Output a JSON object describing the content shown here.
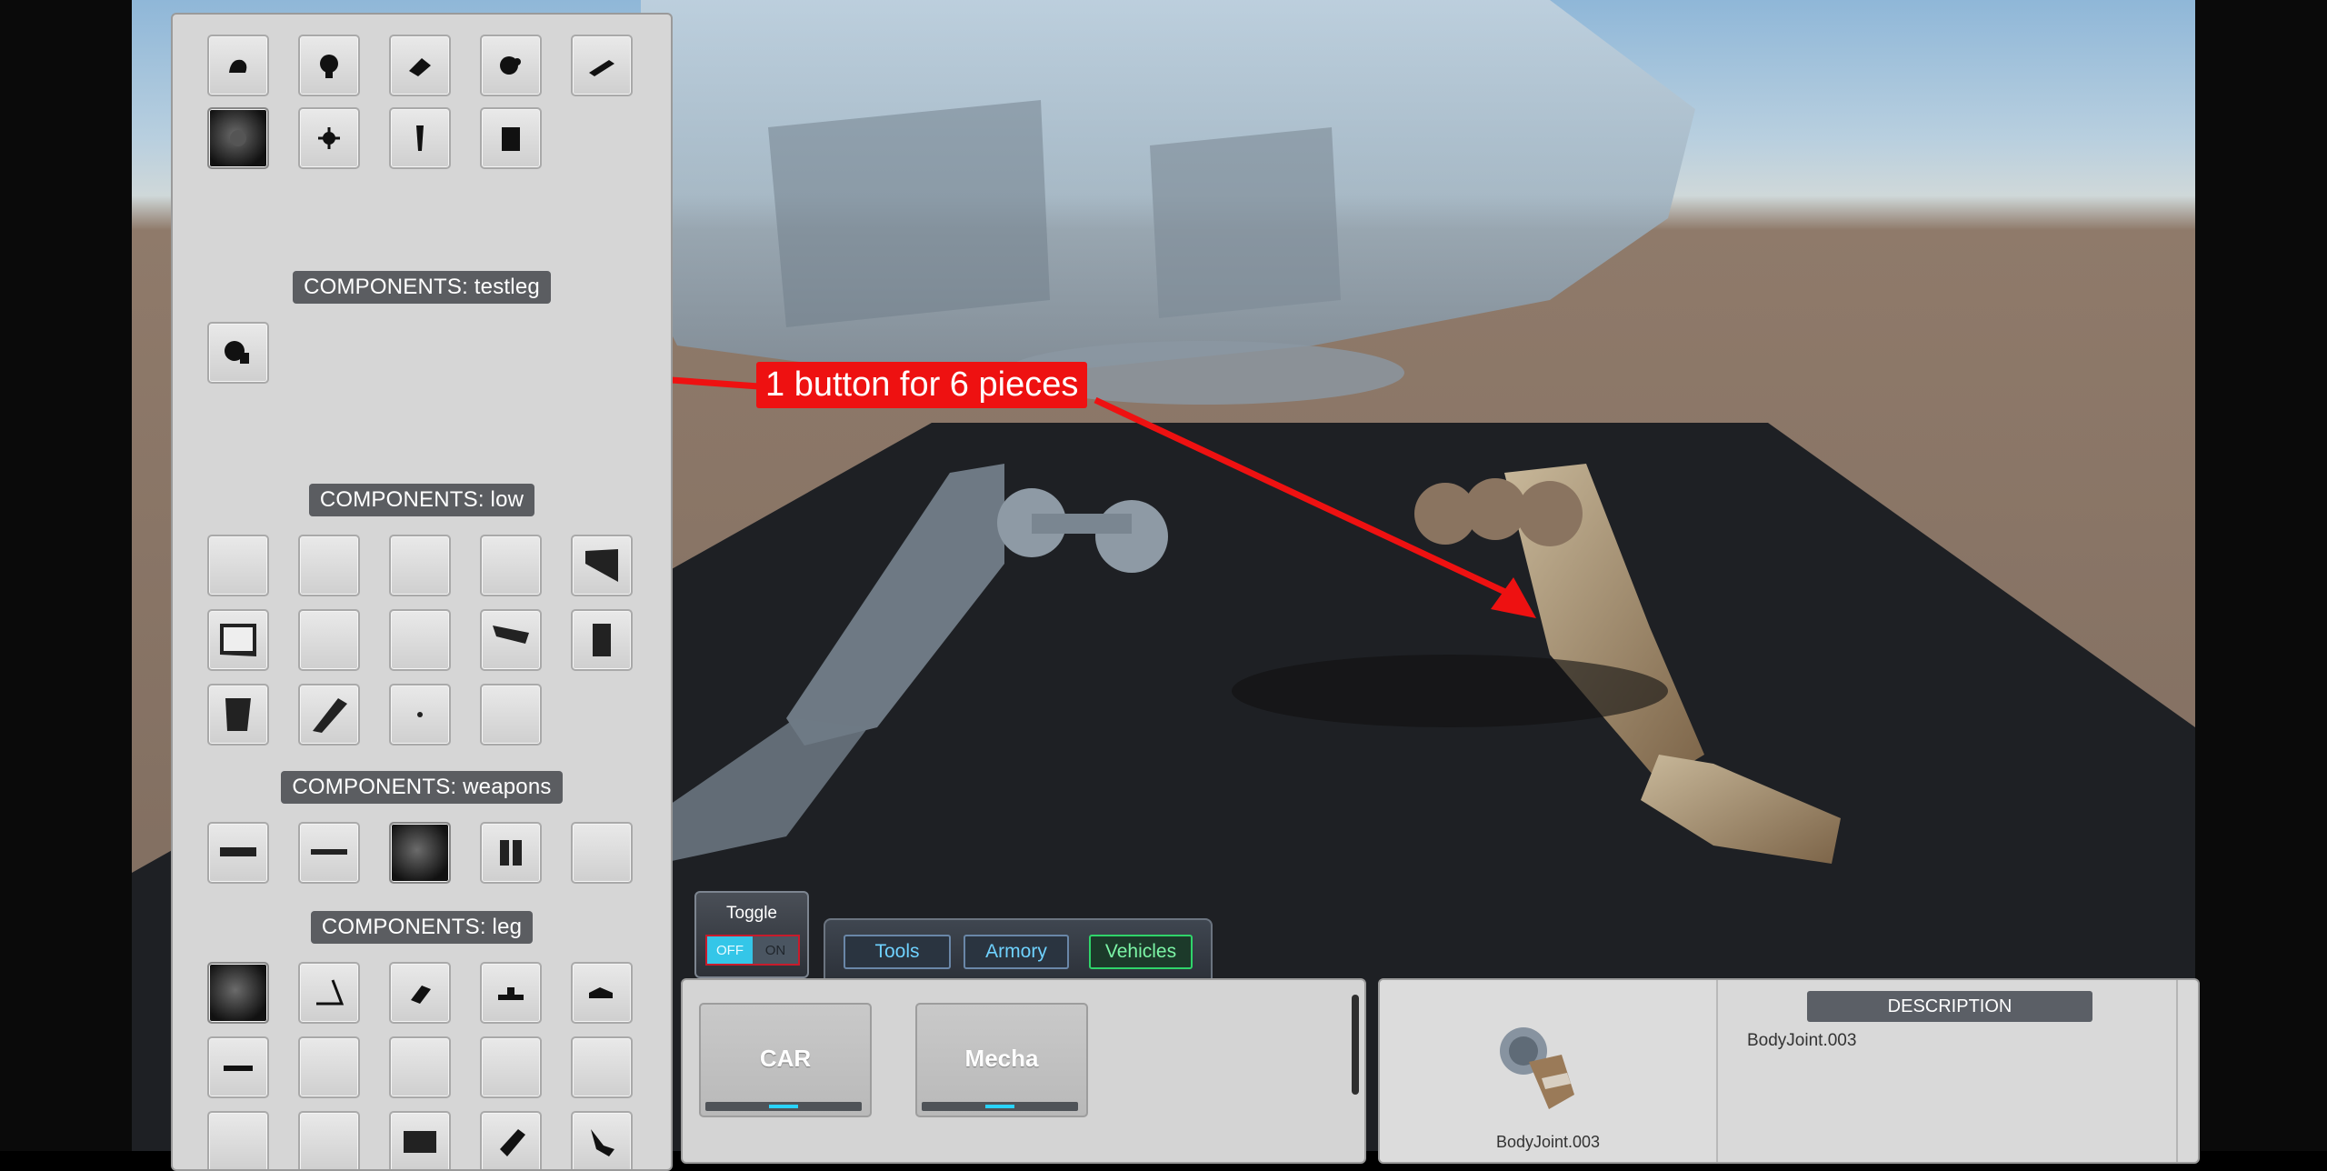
{
  "left_panel": {
    "sections": [
      {
        "title": "COMPONENTS: testleg"
      },
      {
        "title": "COMPONENTS: low"
      },
      {
        "title": "COMPONENTS: weapons"
      },
      {
        "title": "COMPONENTS: leg"
      }
    ]
  },
  "annotation": {
    "text": "1 button for 6 pieces",
    "color": "#ee1111"
  },
  "toggle": {
    "label": "Toggle",
    "off": "OFF",
    "on": "ON",
    "state": "OFF"
  },
  "tabs": {
    "tools": "Tools",
    "armory": "Armory",
    "vehicles": "Vehicles",
    "active": "Vehicles"
  },
  "vehicles": {
    "items": [
      {
        "label": "CAR"
      },
      {
        "label": "Mecha"
      }
    ]
  },
  "description": {
    "header": "DESCRIPTION",
    "text": "BodyJoint.003",
    "caption": "BodyJoint.003"
  },
  "colors": {
    "accent": "#34c6e8",
    "active_tab": "#2fd46a",
    "panel": "#d6d6d6",
    "section_header": "#5b5d61"
  }
}
